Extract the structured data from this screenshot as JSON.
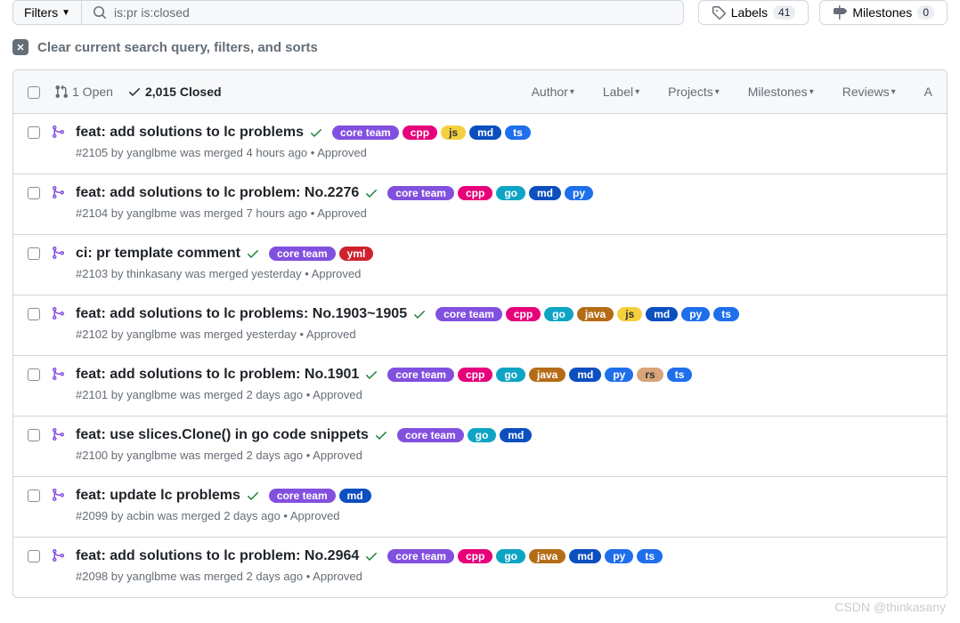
{
  "filters_label": "Filters",
  "search_query": "is:pr is:closed",
  "labels_btn": {
    "text": "Labels",
    "count": "41"
  },
  "milestones_btn": {
    "text": "Milestones",
    "count": "0"
  },
  "clear_text": "Clear current search query, filters, and sorts",
  "states": {
    "open": "1 Open",
    "closed": "2,015 Closed"
  },
  "header_filters": [
    "Author",
    "Label",
    "Projects",
    "Milestones",
    "Reviews",
    "A"
  ],
  "label_colors": {
    "core team": "#8250df",
    "cpp": "#e6007a",
    "js": "#f4d03f",
    "md": "#0c4fbf",
    "ts": "#1f6feb",
    "go": "#0ea5c4",
    "py": "#1f6feb",
    "java": "#b56c17",
    "yml": "#cf222e",
    "rs": "#d8a47a"
  },
  "label_text_colors": {
    "js": "#333",
    "rs": "#333"
  },
  "items": [
    {
      "title": "feat: add solutions to lc problems",
      "labels": [
        "core team",
        "cpp",
        "js",
        "md",
        "ts"
      ],
      "meta": "#2105 by yanglbme was merged 4 hours ago • Approved"
    },
    {
      "title": "feat: add solutions to lc problem: No.2276",
      "labels": [
        "core team",
        "cpp",
        "go",
        "md",
        "py"
      ],
      "meta": "#2104 by yanglbme was merged 7 hours ago • Approved"
    },
    {
      "title": "ci: pr template comment",
      "labels": [
        "core team",
        "yml"
      ],
      "meta": "#2103 by thinkasany was merged yesterday • Approved"
    },
    {
      "title": "feat: add solutions to lc problems: No.1903~1905",
      "labels": [
        "core team",
        "cpp",
        "go",
        "java",
        "js",
        "md",
        "py",
        "ts"
      ],
      "meta": "#2102 by yanglbme was merged yesterday • Approved"
    },
    {
      "title": "feat: add solutions to lc problem: No.1901",
      "labels": [
        "core team",
        "cpp",
        "go",
        "java",
        "md",
        "py",
        "rs",
        "ts"
      ],
      "meta": "#2101 by yanglbme was merged 2 days ago • Approved"
    },
    {
      "title": "feat: use slices.Clone() in go code snippets",
      "labels": [
        "core team",
        "go",
        "md"
      ],
      "meta": "#2100 by yanglbme was merged 2 days ago • Approved"
    },
    {
      "title": "feat: update lc problems",
      "labels": [
        "core team",
        "md"
      ],
      "meta": "#2099 by acbin was merged 2 days ago • Approved"
    },
    {
      "title": "feat: add solutions to lc problem: No.2964",
      "labels": [
        "core team",
        "cpp",
        "go",
        "java",
        "md",
        "py",
        "ts"
      ],
      "meta": "#2098 by yanglbme was merged 2 days ago • Approved"
    }
  ],
  "watermark": "CSDN @thinkasany"
}
